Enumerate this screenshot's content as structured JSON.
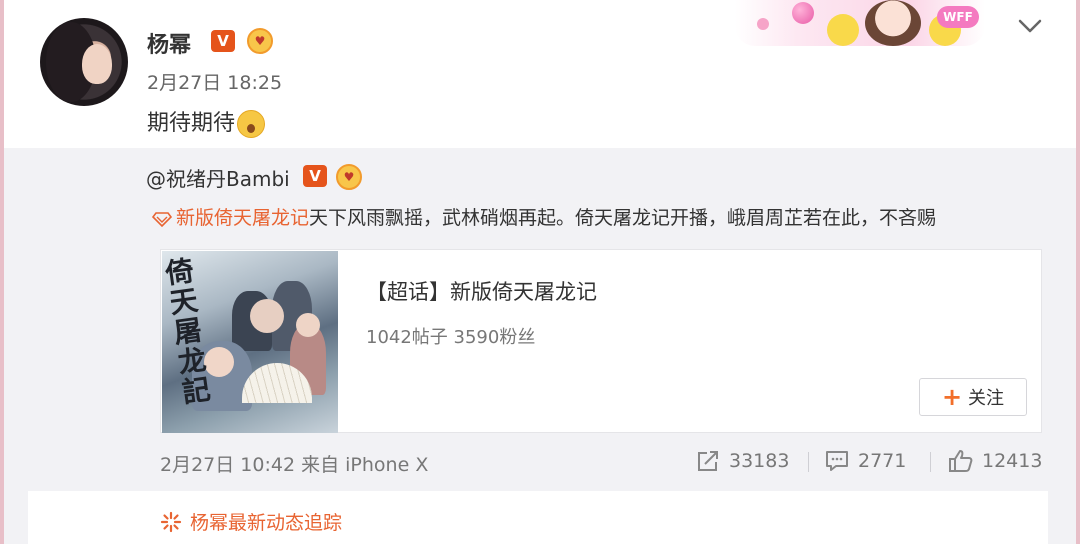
{
  "post": {
    "username": "杨幂",
    "verified_badge": "V",
    "timestamp": "2月27日 18:25",
    "text": "期待期待",
    "emoji": "surprised-face-emoji"
  },
  "header": {
    "banner_label": "WFF",
    "menu_icon": "chevron-down-icon"
  },
  "repost": {
    "username": "@祝绪丹Bambi",
    "verified_badge": "V",
    "topic_link": "新版倚天屠龙记",
    "text": "天下风雨飘摇，武林硝烟再起。倚天屠龙记开播，峨眉周芷若在此，不吝赐",
    "card": {
      "image_text": "倚天屠龙記",
      "title": "【超话】新版倚天屠龙记",
      "stats": "1042帖子 3590粉丝",
      "follow_label": "关注"
    },
    "meta": "2月27日 10:42 来自 iPhone X",
    "actions": {
      "repost_count": "33183",
      "comment_count": "2771",
      "like_count": "12413"
    }
  },
  "tracker": {
    "label": "杨幂最新动态追踪"
  },
  "colors": {
    "accent": "#e86432",
    "verified": "#e5541b",
    "repost_bg": "#f2f2f5"
  }
}
